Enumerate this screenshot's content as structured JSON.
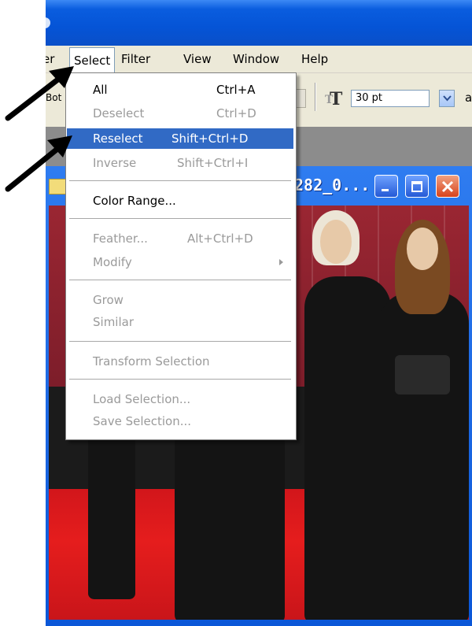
{
  "menubar": {
    "partial_left": "er",
    "items": [
      "Select",
      "Filter",
      "View",
      "Window",
      "Help"
    ],
    "underline_index": [
      0,
      3,
      0,
      0,
      0
    ]
  },
  "toolbar": {
    "partial_left": "Bot",
    "font_size_value": "30 pt",
    "trailing": "a"
  },
  "document": {
    "title_fragment": "282_0..."
  },
  "select_menu": {
    "items": [
      {
        "label": "All",
        "shortcut": "Ctrl+A",
        "state": "enabled"
      },
      {
        "label": "Deselect",
        "shortcut": "Ctrl+D",
        "state": "disabled"
      },
      {
        "label": "Reselect",
        "shortcut": "Shift+Ctrl+D",
        "state": "highlighted"
      },
      {
        "label": "Inverse",
        "shortcut": "Shift+Ctrl+I",
        "state": "disabled"
      },
      {
        "label": "Color Range...",
        "shortcut": "",
        "state": "enabled"
      },
      {
        "label": "Feather...",
        "shortcut": "Alt+Ctrl+D",
        "state": "disabled"
      },
      {
        "label": "Modify",
        "shortcut": "",
        "state": "disabled",
        "submenu": true
      },
      {
        "label": "Grow",
        "shortcut": "",
        "state": "disabled"
      },
      {
        "label": "Similar",
        "shortcut": "",
        "state": "disabled"
      },
      {
        "label": "Transform Selection",
        "shortcut": "",
        "state": "disabled"
      },
      {
        "label": "Load Selection...",
        "shortcut": "",
        "state": "disabled"
      },
      {
        "label": "Save Selection...",
        "shortcut": "",
        "state": "disabled"
      }
    ]
  },
  "colors": {
    "xp_blue": "#0a5ddf",
    "menu_highlight": "#316ac5",
    "disabled_text": "#9a9a9a",
    "close_button": "#d8431c",
    "carpet_red": "#e51d1d"
  },
  "icons": [
    "text-tool-icon",
    "dropdown-arrow-icon",
    "minimize-icon",
    "maximize-icon",
    "close-icon",
    "submenu-arrow-icon",
    "pointer-arrow-icon",
    "document-icon"
  ]
}
